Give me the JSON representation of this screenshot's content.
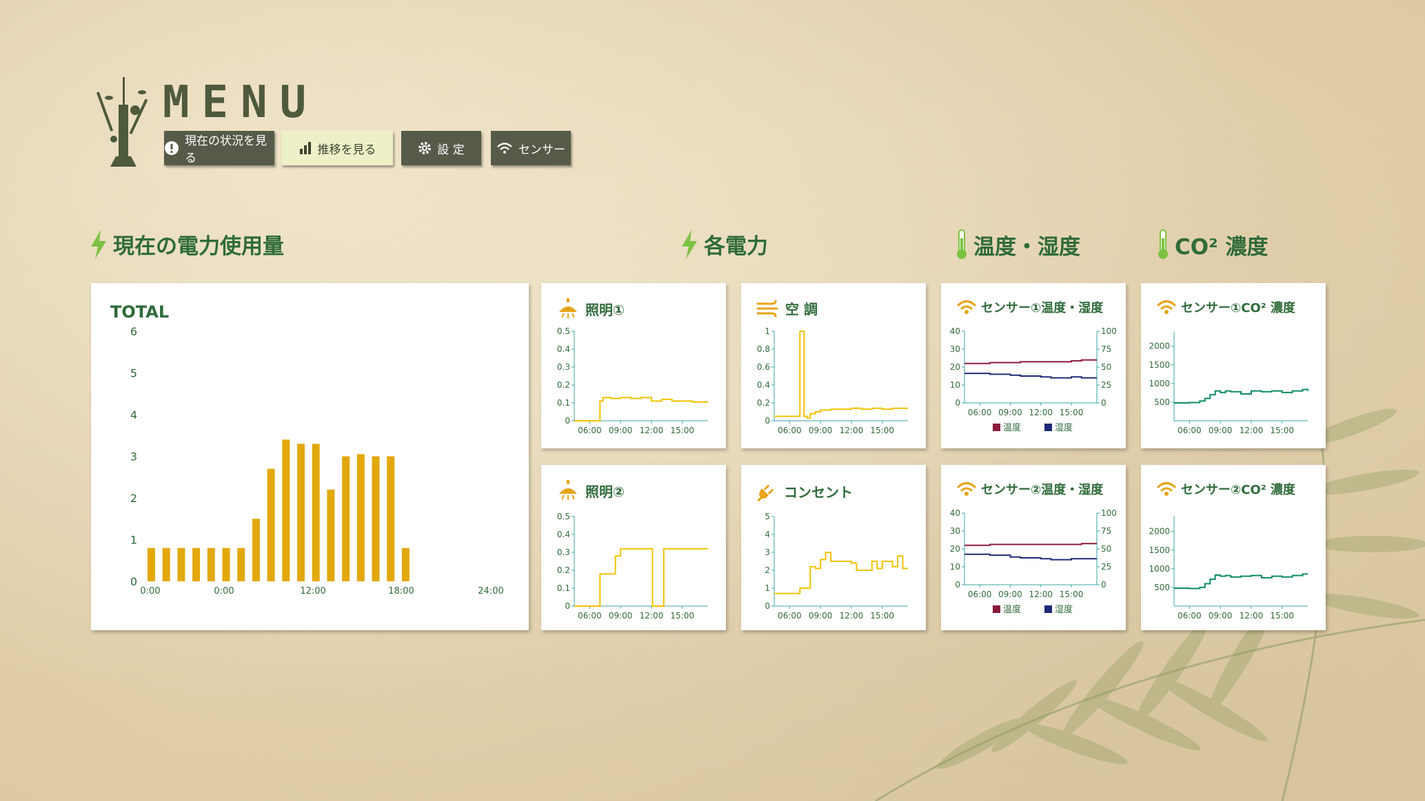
{
  "header": {
    "title": "MENU",
    "nav": [
      {
        "label": "現在の状況を見る",
        "icon": "exclamation-icon",
        "active": false
      },
      {
        "label": "推移を見る",
        "icon": "bar-chart-icon",
        "active": true
      },
      {
        "label": "設 定",
        "icon": "gear-icon",
        "active": false
      },
      {
        "label": "センサー",
        "icon": "wifi-icon",
        "active": false
      }
    ]
  },
  "sections": {
    "current_power": "現在の電力使用量",
    "each_power": "各電力",
    "temp_humidity": "温度・湿度",
    "co2": "CO² 濃度"
  },
  "colors": {
    "accent_green": "#2f6b3a",
    "bar_gold": "#e2a80c",
    "line_yellow": "#f2c200",
    "temp_red": "#8b1a3a",
    "humidity_navy": "#1e2a78",
    "co2_teal": "#0d8a6a",
    "axis_teal": "#3aa6a6"
  },
  "cards": {
    "total": {
      "title": "TOTAL"
    },
    "light1": {
      "title": "照明①",
      "icon": "ceiling-light-icon"
    },
    "aircon": {
      "title": "空 調",
      "icon": "wind-icon"
    },
    "light2": {
      "title": "照明②",
      "icon": "ceiling-light-icon"
    },
    "outlet": {
      "title": "コンセント",
      "icon": "plug-icon"
    },
    "sensor1_th": {
      "title": "センサー①温度・湿度",
      "icon": "wifi-icon"
    },
    "sensor2_th": {
      "title": "センサー②温度・湿度",
      "icon": "wifi-icon"
    },
    "sensor1_co2": {
      "title": "センサー①CO² 濃度",
      "icon": "wifi-icon"
    },
    "sensor2_co2": {
      "title": "センサー②CO² 濃度",
      "icon": "wifi-icon"
    }
  },
  "chart_data": [
    {
      "id": "total",
      "type": "bar",
      "title": "TOTAL",
      "ylim": [
        0,
        6
      ],
      "yticks": [
        "0",
        "1",
        "2",
        "3",
        "4",
        "5",
        "6"
      ],
      "xticks": [
        "0:00",
        "0:00",
        "12:00",
        "18:00",
        "24:00"
      ],
      "values": [
        0.8,
        0.8,
        0.8,
        0.8,
        0.8,
        0.8,
        0.8,
        1.5,
        2.7,
        3.4,
        3.3,
        3.3,
        2.2,
        3.0,
        3.05,
        3.0,
        3.0,
        0.8
      ],
      "grid": false
    },
    {
      "id": "light1",
      "type": "line",
      "ylim": [
        0,
        0.5
      ],
      "yticks": [
        "0",
        "0.1",
        "0.2",
        "0.3",
        "0.4",
        "0.5"
      ],
      "xticks": [
        "06:00",
        "09:00",
        "12:00",
        "15:00"
      ],
      "x": [
        4.5,
        5.4,
        6.8,
        7.0,
        7.3,
        8.0,
        9.0,
        10.0,
        11.0,
        12.0,
        13.0,
        14.0,
        15.0,
        16.0,
        17.5
      ],
      "series": [
        {
          "values": [
            0,
            0,
            0,
            0.11,
            0.13,
            0.125,
            0.13,
            0.125,
            0.13,
            0.11,
            0.12,
            0.11,
            0.11,
            0.105,
            0.105
          ]
        }
      ]
    },
    {
      "id": "aircon",
      "type": "line",
      "ylim": [
        0,
        1
      ],
      "yticks": [
        "0",
        "0.2",
        "0.4",
        "0.6",
        "0.8",
        "1"
      ],
      "xticks": [
        "06:00",
        "09:00",
        "12:00",
        "15:00"
      ],
      "x": [
        4.5,
        6.5,
        6.7,
        7.0,
        7.2,
        7.4,
        7.7,
        8.0,
        8.5,
        9.0,
        10.0,
        11.0,
        12.0,
        13.0,
        14.0,
        15.0,
        16.0,
        17.5
      ],
      "series": [
        {
          "values": [
            0.05,
            0.05,
            0.05,
            1.0,
            1.0,
            0.05,
            0.03,
            0.08,
            0.1,
            0.12,
            0.13,
            0.13,
            0.14,
            0.13,
            0.14,
            0.13,
            0.14,
            0.14
          ]
        }
      ]
    },
    {
      "id": "light2",
      "type": "line",
      "ylim": [
        0,
        0.5
      ],
      "yticks": [
        "0",
        "0.1",
        "0.2",
        "0.3",
        "0.4",
        "0.5"
      ],
      "xticks": [
        "06:00",
        "09:00",
        "12:00",
        "15:00"
      ],
      "x": [
        4.5,
        6.8,
        7.0,
        7.5,
        8.5,
        9.0,
        9.5,
        10.5,
        11.9,
        12.1,
        13.0,
        13.2,
        15.0,
        17.5
      ],
      "series": [
        {
          "values": [
            0,
            0,
            0.18,
            0.18,
            0.28,
            0.32,
            0.32,
            0.32,
            0.32,
            0,
            0,
            0.32,
            0.32,
            0.32
          ]
        }
      ]
    },
    {
      "id": "outlet",
      "type": "line",
      "ylim": [
        0,
        5
      ],
      "yticks": [
        "0",
        "1",
        "2",
        "3",
        "4",
        "5"
      ],
      "xticks": [
        "06:00",
        "09:00",
        "12:00",
        "15:00"
      ],
      "x": [
        4.5,
        6.0,
        6.5,
        7.0,
        8.0,
        8.5,
        9.0,
        9.5,
        10.0,
        11.0,
        12.0,
        12.5,
        13.0,
        14.0,
        14.5,
        15.0,
        16.0,
        16.5,
        17.0,
        17.5
      ],
      "series": [
        {
          "values": [
            0.7,
            0.7,
            0.7,
            1.0,
            2.2,
            2.1,
            2.6,
            3.0,
            2.5,
            2.5,
            2.4,
            2.0,
            2.0,
            2.5,
            2.1,
            2.5,
            2.2,
            2.8,
            2.1,
            2.1
          ]
        }
      ]
    },
    {
      "id": "sensor1_th",
      "type": "line",
      "ylim": [
        0,
        40
      ],
      "y2lim": [
        0,
        100
      ],
      "yticks": [
        "0",
        "10",
        "20",
        "30",
        "40"
      ],
      "y2ticks": [
        "0",
        "25",
        "50",
        "75",
        "100"
      ],
      "xticks": [
        "06:00",
        "09:00",
        "12:00",
        "15:00"
      ],
      "x": [
        4.5,
        6.0,
        7.0,
        9.0,
        10.0,
        12.0,
        13.0,
        15.0,
        16.0,
        17.5
      ],
      "series": [
        {
          "name": "温度",
          "values": [
            22,
            22,
            22.5,
            22.5,
            23,
            23,
            23,
            23.5,
            24,
            24
          ]
        },
        {
          "name": "湿度",
          "values": [
            16.5,
            16.5,
            16,
            15.5,
            15,
            14.5,
            14,
            14.5,
            14,
            14
          ]
        }
      ],
      "legend": "bottom"
    },
    {
      "id": "sensor2_th",
      "type": "line",
      "ylim": [
        0,
        40
      ],
      "y2lim": [
        0,
        100
      ],
      "yticks": [
        "0",
        "10",
        "20",
        "30",
        "40"
      ],
      "y2ticks": [
        "0",
        "25",
        "50",
        "75",
        "100"
      ],
      "xticks": [
        "06:00",
        "09:00",
        "12:00",
        "15:00"
      ],
      "x": [
        4.5,
        6.0,
        7.0,
        9.0,
        10.0,
        12.0,
        13.0,
        15.0,
        16.0,
        17.5
      ],
      "series": [
        {
          "name": "温度",
          "values": [
            22,
            22,
            22.5,
            22.5,
            22.5,
            22.5,
            22.5,
            22.5,
            23,
            23
          ]
        },
        {
          "name": "湿度",
          "values": [
            17,
            17,
            16.5,
            15.5,
            15,
            14.5,
            14,
            14.5,
            14.5,
            14.5
          ]
        }
      ],
      "legend": "bottom"
    },
    {
      "id": "sensor1_co2",
      "type": "line",
      "ylim": [
        0,
        2400
      ],
      "yticks": [
        "500",
        "1000",
        "1500",
        "2000"
      ],
      "xticks": [
        "06:00",
        "09:00",
        "12:00",
        "15:00"
      ],
      "x": [
        4.5,
        6.0,
        7.0,
        7.5,
        8.0,
        8.5,
        9.0,
        9.5,
        10.0,
        11.0,
        12.0,
        13.0,
        14.0,
        15.0,
        16.0,
        17.0,
        17.5
      ],
      "series": [
        {
          "values": [
            480,
            490,
            530,
            600,
            700,
            800,
            760,
            800,
            780,
            720,
            800,
            780,
            800,
            760,
            800,
            840,
            800
          ]
        }
      ]
    },
    {
      "id": "sensor2_co2",
      "type": "line",
      "ylim": [
        0,
        2400
      ],
      "yticks": [
        "500",
        "1000",
        "1500",
        "2000"
      ],
      "xticks": [
        "06:00",
        "09:00",
        "12:00",
        "15:00"
      ],
      "x": [
        4.5,
        6.0,
        7.0,
        7.5,
        8.0,
        8.5,
        9.0,
        9.5,
        10.0,
        11.0,
        12.0,
        13.0,
        14.0,
        15.0,
        16.0,
        17.0,
        17.5
      ],
      "series": [
        {
          "values": [
            480,
            470,
            500,
            600,
            720,
            830,
            800,
            820,
            780,
            800,
            820,
            760,
            800,
            780,
            820,
            860,
            860
          ]
        }
      ]
    }
  ]
}
